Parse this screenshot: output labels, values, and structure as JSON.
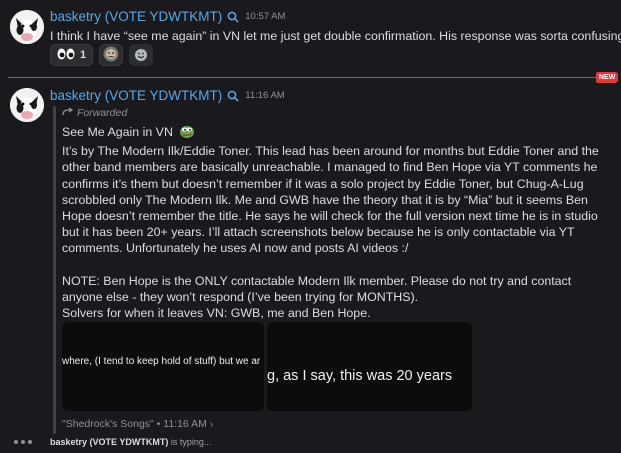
{
  "message1": {
    "username": "basketry (VOTE YDWTKMT)",
    "timestamp": "10:57 AM",
    "text": "I think I have “see me again” in VN let me just get double confirmation. His response was sorta confusing",
    "reactions": [
      {
        "emoji_icon": "eyes-emoji-icon",
        "count": "1"
      },
      {
        "emoji_icon": "custom-face-emoji-icon",
        "count": ""
      }
    ]
  },
  "divider": {
    "badge": "NEW"
  },
  "message2": {
    "username": "basketry (VOTE YDWTKMT)",
    "timestamp": "11:16 AM",
    "forwarded_label": "Forwarded",
    "title": "See Me Again in VN",
    "paragraph1": "It’s by The Modern Ilk/Eddie Toner. This lead has been around for months but Eddie Toner and the other band members are basically  unreachable. I managed to find Ben Hope via YT comments he confirms it’s them but doesn’t remember if it was a solo project by Eddie Toner, but Chug-A-Lug scrobbled only The Modern Ilk. Me and GWB have the theory that it is by “Mia” but it seems Ben Hope doesn’t remember the title. He says he will check for the full version next time he is in studio but it has been 20+ years. I’ll attach screenshots below because he is only contactable via YT comments. Unfortunately he uses AI now and posts AI videos :/",
    "paragraph2": "NOTE: Ben Hope is the ONLY contactable Modern Ilk member. Please do not try and contact anyone else - they won’t respond (I’ve been trying for MONTHS).",
    "paragraph3": "Solvers for when it leaves VN: GWB, me and Ben Hope.",
    "image1_text": "where, (I tend to keep hold of stuff)  but we ar",
    "image2_text": "g, as I say, this was 20 years",
    "source": "\"Shedrock's Songs\" • 11:16 AM ›"
  },
  "typing": {
    "name": "basketry (VOTE YDWTKMT)",
    "suffix": " is typing..."
  },
  "colors": {
    "background": "#1a1a1e",
    "username": "#5ba7e5",
    "new_divider": "#d83c3e"
  }
}
